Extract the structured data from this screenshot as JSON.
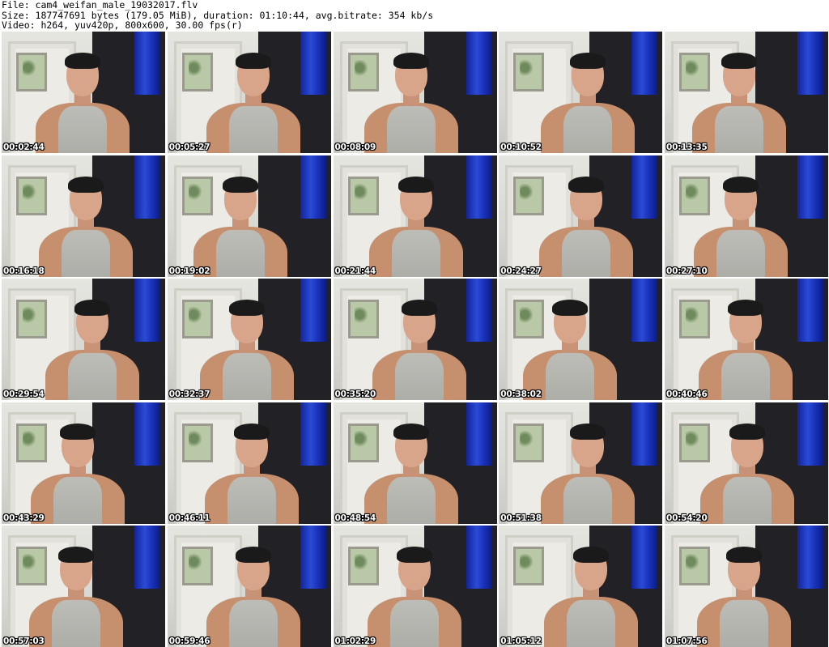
{
  "header": {
    "line1": "File: cam4_weifan_male_19032017.flv",
    "line2": "Size: 187747691 bytes (179.05 MiB), duration: 01:10:44, avg.bitrate: 354 kb/s",
    "line3": "Video: h264, yuv420p, 800x600, 30.00 fps(r)"
  },
  "thumbnails": [
    "00:02:44",
    "00:05:27",
    "00:08:09",
    "00:10:52",
    "00:13:35",
    "00:16:18",
    "00:19:02",
    "00:21:44",
    "00:24:27",
    "00:27:10",
    "00:29:54",
    "00:32:37",
    "00:35:20",
    "00:38:02",
    "00:40:46",
    "00:43:29",
    "00:46:11",
    "00:48:54",
    "00:51:38",
    "00:54:20",
    "00:57:03",
    "00:59:46",
    "01:02:29",
    "01:05:12",
    "01:07:56"
  ]
}
